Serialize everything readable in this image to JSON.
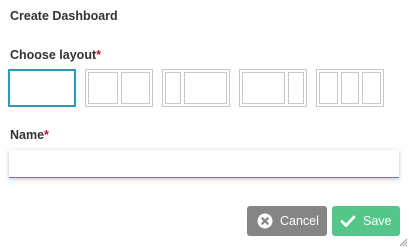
{
  "dialog": {
    "title": "Create Dashboard"
  },
  "layout": {
    "label": "Choose layout",
    "required_marker": "*",
    "options": [
      {
        "id": "one-column",
        "columns": [
          1
        ],
        "selected": true
      },
      {
        "id": "two-equal-columns",
        "columns": [
          1,
          1
        ],
        "selected": false
      },
      {
        "id": "narrow-wide",
        "columns": [
          1,
          3
        ],
        "selected": false
      },
      {
        "id": "wide-narrow",
        "columns": [
          3,
          1
        ],
        "selected": false
      },
      {
        "id": "three-columns",
        "columns": [
          1,
          1,
          1
        ],
        "selected": false
      }
    ]
  },
  "name": {
    "label": "Name",
    "required_marker": "*",
    "value": "",
    "placeholder": ""
  },
  "buttons": {
    "cancel_label": "Cancel",
    "save_label": "Save"
  },
  "colors": {
    "accent": "#2a9cb7",
    "required": "#c8102e",
    "cancel_bg": "#858585",
    "save_bg": "#54c68a"
  },
  "icons": {
    "cancel": "close-circle-icon",
    "save": "checkmark-icon",
    "resize": "resize-grip-icon"
  }
}
